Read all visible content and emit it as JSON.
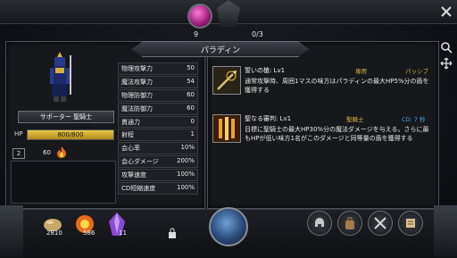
{
  "top": {
    "left_count": "9",
    "right_count": "0/3"
  },
  "panel_title": "パラディン",
  "unit": {
    "role_label": "サポーター 聖騎士",
    "hp_label": "HP",
    "hp_text": "800/800",
    "hp_fraction": 1.0,
    "level": "2",
    "cost": "60"
  },
  "stats": [
    {
      "name": "物理攻撃力",
      "value": "50"
    },
    {
      "name": "魔法攻撃力",
      "value": "54"
    },
    {
      "name": "物理防御力",
      "value": "60"
    },
    {
      "name": "魔法防御力",
      "value": "60"
    },
    {
      "name": "貫通力",
      "value": "0"
    },
    {
      "name": "射程",
      "value": "1"
    },
    {
      "name": "会心率",
      "value": "10%"
    },
    {
      "name": "会心ダメージ",
      "value": "200%"
    },
    {
      "name": "攻撃速度",
      "value": "100%"
    },
    {
      "name": "CD短縮速度",
      "value": "100%"
    }
  ],
  "skills": [
    {
      "name": "誓いの槍: Lv1",
      "tag1": "専用",
      "tag2": "パッシブ",
      "desc": "通常攻撃時、周囲1マスの味方はパラディンの最大HP5%分の盾を獲得する"
    },
    {
      "name": "聖なる審判: Lv1",
      "tag1": "聖騎士",
      "tag2": "CD: 7 秒",
      "desc": "目標に聖騎士の最大HP30%分の魔法ダメージを与える。さらに最もHPが低い味方1名がこのダメージと同等量の盾を獲得する"
    }
  ],
  "resources": [
    {
      "name": "seed",
      "value": "2810"
    },
    {
      "name": "fire-essence",
      "value": "586"
    },
    {
      "name": "crystal",
      "value": "11"
    }
  ],
  "colors": {
    "tag_gold": "#e0b84a",
    "tag_blue": "#4aa8e8",
    "hp_gold": "#e8c84a"
  }
}
